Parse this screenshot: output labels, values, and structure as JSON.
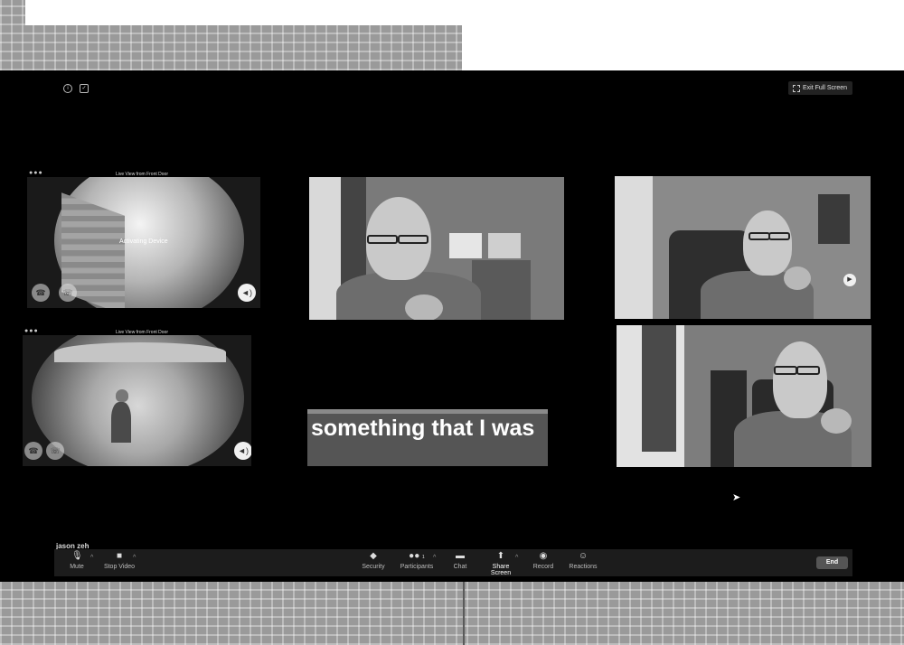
{
  "header": {
    "exit_full_screen_label": "Exit Full Screen"
  },
  "tiles": {
    "front_door_top": {
      "caption": "Live View from Front Door",
      "status": "Activating Device"
    },
    "front_door_bottom": {
      "caption": "Live View from Front Door"
    }
  },
  "captions": {
    "text": "something that I was"
  },
  "participant": {
    "name": "jason zeh"
  },
  "toolbar": {
    "mute_label": "Mute",
    "stop_video_label": "Stop Video",
    "security_label": "Security",
    "participants_label": "Participants",
    "participants_count": "1",
    "chat_label": "Chat",
    "share_screen_label": "Share Screen",
    "record_label": "Record",
    "reactions_label": "Reactions",
    "end_label": "End"
  }
}
